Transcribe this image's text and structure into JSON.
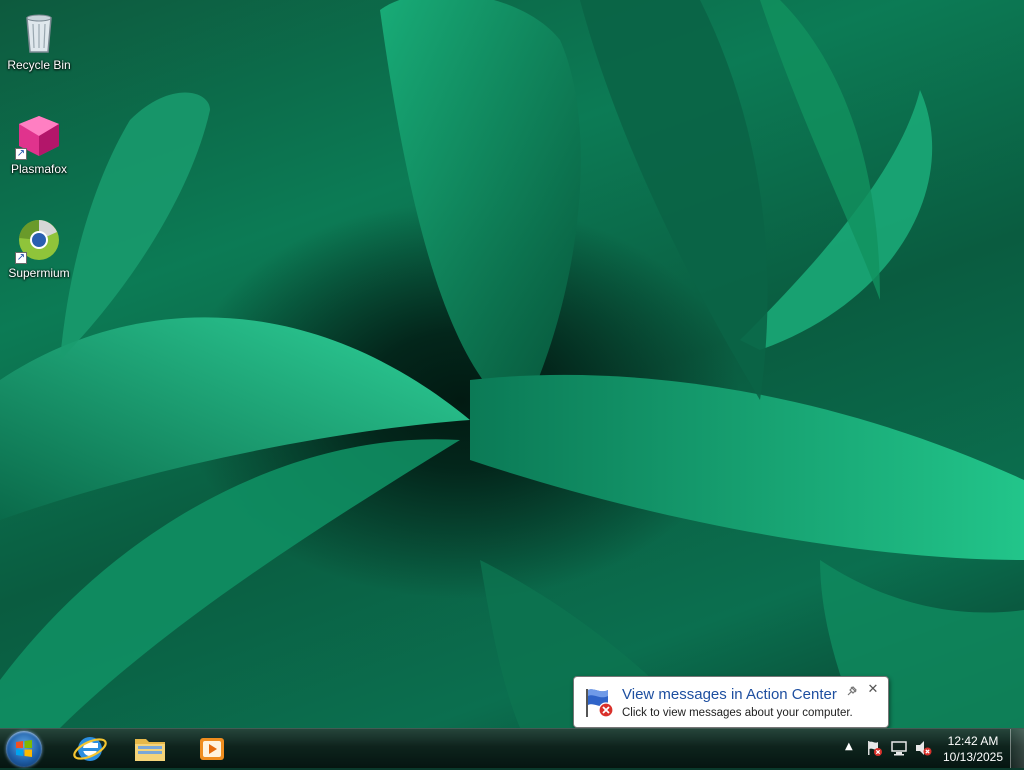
{
  "desktop": {
    "icons": [
      {
        "label": "Recycle Bin"
      },
      {
        "label": "Plasmafox"
      },
      {
        "label": "Supermium"
      }
    ]
  },
  "balloon": {
    "title": "View messages in Action Center",
    "text": "Click to view messages about your computer.",
    "close_label": "✕",
    "icon": "action-center-flag-icon"
  },
  "taskbar": {
    "pinned": [
      "internet-explorer-icon",
      "file-explorer-icon",
      "media-player-icon"
    ],
    "tray_arrow": "▲",
    "tray_icons": [
      "action-center-flag-icon",
      "network-icon",
      "volume-muted-icon"
    ],
    "clock": {
      "time": "12:42 AM",
      "date": "10/13/2025"
    }
  },
  "colors": {
    "balloon_title": "#1e4fa0",
    "wallpaper_green": "#0c7b55"
  }
}
